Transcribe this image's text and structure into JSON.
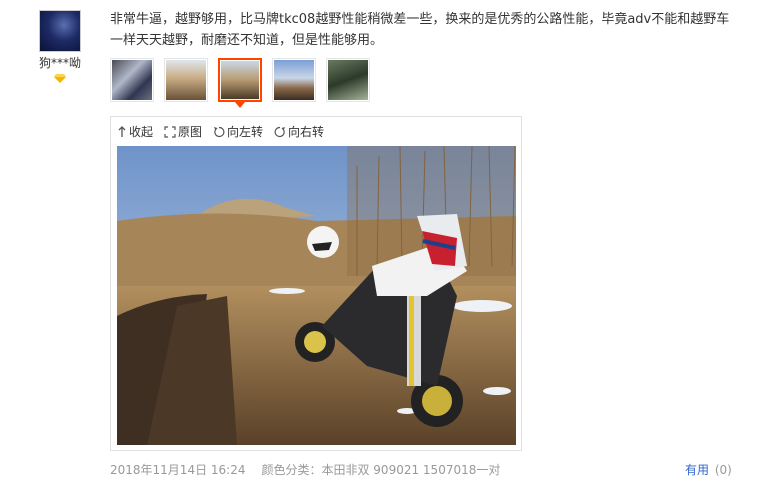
{
  "user": {
    "name": "狗***呦",
    "avatar_icon": "avatar-image",
    "badge_icon": "vip-diamond-icon"
  },
  "review": {
    "text": "非常牛逼，越野够用，比马牌tkc08越野性能稍微差一些，换来的是优秀的公路性能，毕竟adv不能和越野车一样天天越野，耐磨还不知道，但是性能够用。"
  },
  "thumbnails": [
    {
      "active": false
    },
    {
      "active": false
    },
    {
      "active": true
    },
    {
      "active": false
    },
    {
      "active": false
    }
  ],
  "viewer": {
    "collapse_label": "收起",
    "original_label": "原图",
    "rotate_left_label": "向左转",
    "rotate_right_label": "向右转"
  },
  "footer": {
    "date": "2018年11月14日 16:24",
    "sku": "颜色分类：本田非双 909021 1507018一对",
    "useful_label": "有用",
    "useful_count": "(0)"
  },
  "colors": {
    "accent": "#ff4400",
    "link": "#3366cc",
    "muted": "#999999"
  }
}
